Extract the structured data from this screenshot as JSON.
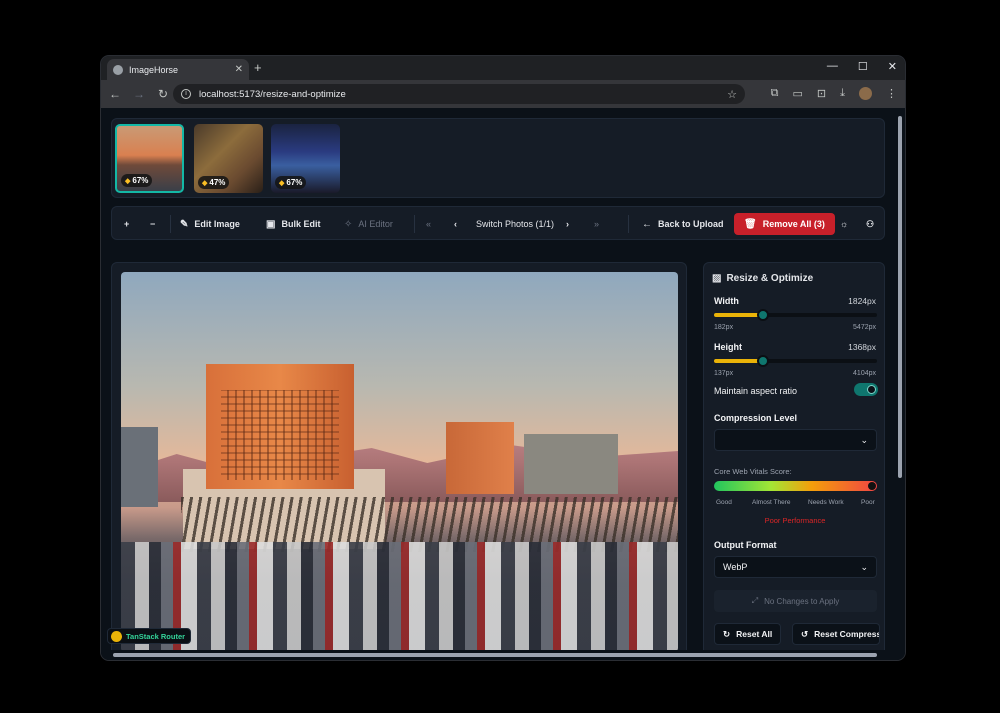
{
  "browser": {
    "tab_title": "ImageHorse",
    "url": "localhost:5173/resize-and-optimize",
    "controls": {
      "minimize": "—",
      "maximize": "☐",
      "close": "✕"
    }
  },
  "thumbnails": [
    {
      "score": "67%",
      "selected": true
    },
    {
      "score": "47%",
      "selected": false
    },
    {
      "score": "67%",
      "selected": false
    }
  ],
  "toolbar": {
    "zoom_in": "+",
    "zoom_out": "−",
    "edit_image": "Edit Image",
    "bulk_edit": "Bulk Edit",
    "ai_editor": "AI Editor",
    "switch_photos": "Switch Photos (1/1)",
    "back_to_upload": "Back to Upload",
    "remove_all": "Remove All (3)"
  },
  "panel": {
    "title": "Resize & Optimize",
    "width": {
      "label": "Width",
      "value": "1824px",
      "min": "182px",
      "max": "5472px",
      "fraction": 0.3
    },
    "height": {
      "label": "Height",
      "value": "1368px",
      "min": "137px",
      "max": "4104px",
      "fraction": 0.3
    },
    "aspect_label": "Maintain aspect ratio",
    "aspect_on": true,
    "compression_label": "Compression Level",
    "compression_value": "",
    "cwv_label": "Core Web Vitals Score:",
    "cwv_scale": [
      "Good",
      "Almost There",
      "Needs Work",
      "Poor"
    ],
    "cwv_status": "Poor Performance",
    "output_format_label": "Output Format",
    "output_format_value": "WebP",
    "no_changes": "No Changes to Apply",
    "reset_all": "Reset All",
    "reset_compression": "Reset Compression"
  },
  "devtools_badge": "TanStack Router",
  "colors": {
    "accent": "#0f766e",
    "danger": "#c8202a",
    "slider": "#eab308"
  }
}
